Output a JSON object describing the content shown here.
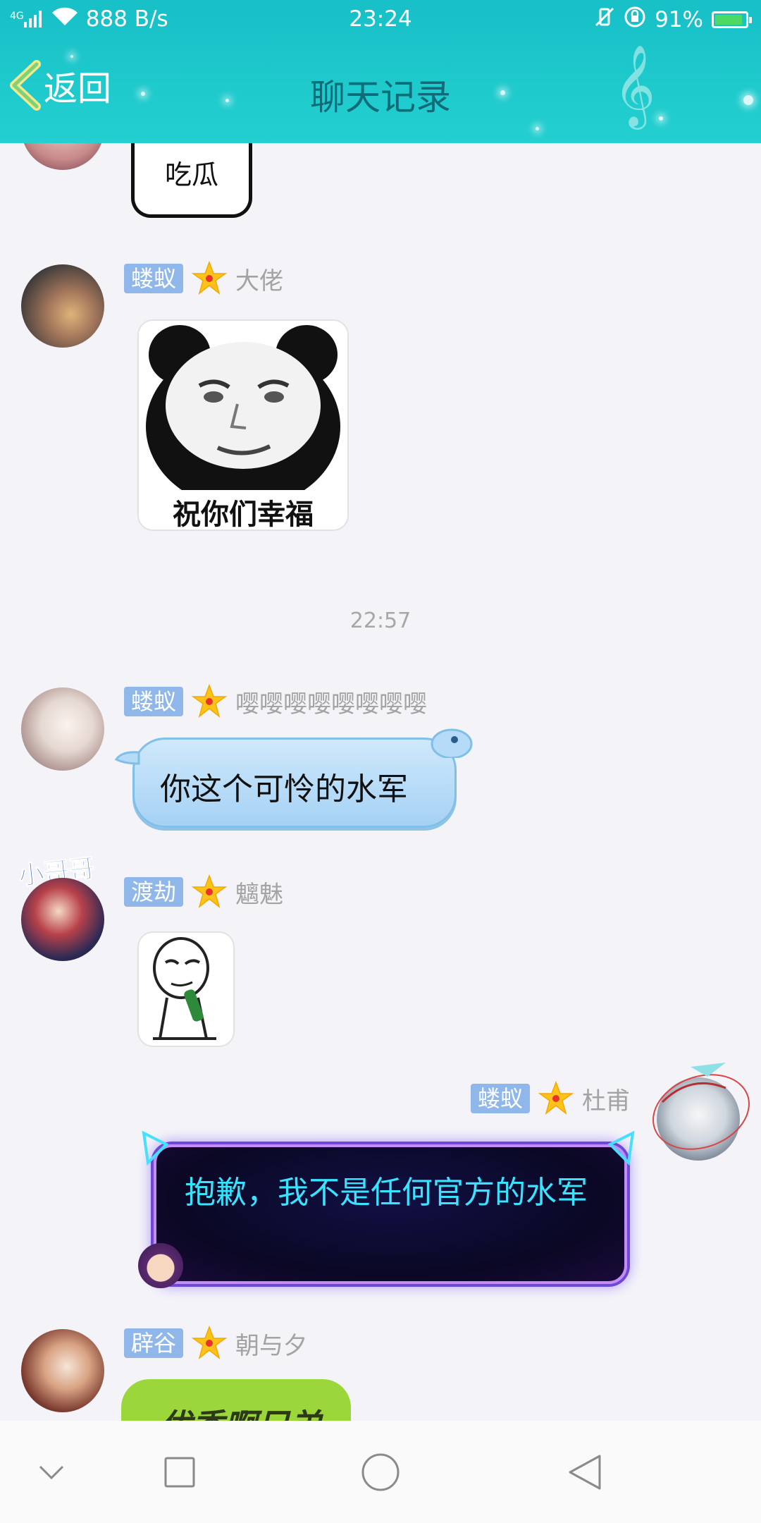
{
  "status_bar": {
    "network": "4G",
    "speed": "888 B/s",
    "time": "23:24",
    "battery_percent": "91%",
    "battery_level": 0.91
  },
  "header": {
    "back_label": "返回",
    "title": "聊天记录"
  },
  "colors": {
    "header_bg": "#1ec9cc",
    "title_color": "#0f6b77",
    "badge_bg": "#90b7ea",
    "nick_color": "#a3a3a3"
  },
  "messages": [
    {
      "type": "sticker-partial",
      "sticker_text": "吃瓜"
    },
    {
      "type": "sticker",
      "badge": "蝼蚁",
      "nickname": "大佬",
      "sticker_caption": "祝你们幸福",
      "sticker_icon": "panda-face-sticker"
    },
    {
      "type": "timestamp",
      "time": "22:57"
    },
    {
      "type": "text",
      "badge": "蝼蚁",
      "nickname": "嘤嘤嘤嘤嘤嘤嘤嘤",
      "text": "你这个可怜的水军"
    },
    {
      "type": "sticker",
      "badge": "渡劫",
      "nickname": "魑魅",
      "avatar_caption": "小哥哥",
      "sticker_icon": "meme-face-sticker"
    },
    {
      "type": "text",
      "side": "right",
      "badge": "蝼蚁",
      "nickname": "杜甫",
      "text": "抱歉，我不是任何官方的水军"
    },
    {
      "type": "text-partial",
      "badge": "辟谷",
      "nickname": "朝与夕",
      "text": "优秀啊兄弟"
    }
  ],
  "bottom_nav": {
    "icons": [
      "chevron-down-icon",
      "square-icon",
      "circle-icon",
      "triangle-back-icon"
    ]
  }
}
